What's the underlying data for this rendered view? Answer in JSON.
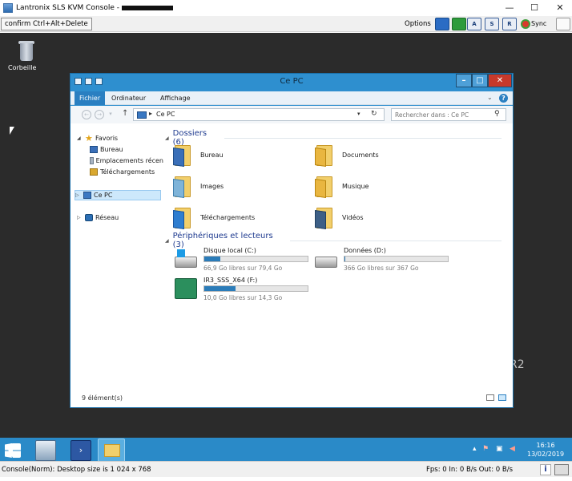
{
  "kvm": {
    "title": "Lantronix SLS KVM Console - ",
    "cad_button": "confirm Ctrl+Alt+Delete",
    "options_label": "Options",
    "key_buttons": [
      "A",
      "S",
      "R"
    ],
    "sync_label": "Sync",
    "status_left": "Console(Norm): Desktop size is 1 024 x 768",
    "status_right": "Fps: 0 In: 0 B/s Out: 0 B/s"
  },
  "desktop": {
    "recycle_bin": "Corbeille",
    "watermark": "R2"
  },
  "explorer": {
    "title": "Ce PC",
    "ribbon_tabs": [
      "Fichier",
      "Ordinateur",
      "Affichage"
    ],
    "address_path": "Ce PC",
    "search_placeholder": "Rechercher dans : Ce PC",
    "nav": {
      "favorites": "Favoris",
      "bureau": "Bureau",
      "recent": "Emplacements récen",
      "downloads": "Téléchargements",
      "this_pc": "Ce PC",
      "network": "Réseau"
    },
    "folders_header": "Dossiers (6)",
    "folders": [
      "Bureau",
      "Documents",
      "Images",
      "Musique",
      "Téléchargements",
      "Vidéos"
    ],
    "devices_header": "Périphériques et lecteurs (3)",
    "drives": [
      {
        "name": "Disque local (C:)",
        "free": "66,9 Go libres sur 79,4 Go",
        "used_fraction": 0.157
      },
      {
        "name": "Données (D:)",
        "free": "366 Go libres sur 367 Go",
        "used_fraction": 0.003
      },
      {
        "name": "IR3_SSS_X64 (F:)",
        "free": "10,0 Go libres sur 14,3 Go",
        "used_fraction": 0.3
      }
    ],
    "status": "9 élément(s)"
  },
  "taskbar": {
    "time": "16:16",
    "date": "13/02/2019"
  }
}
